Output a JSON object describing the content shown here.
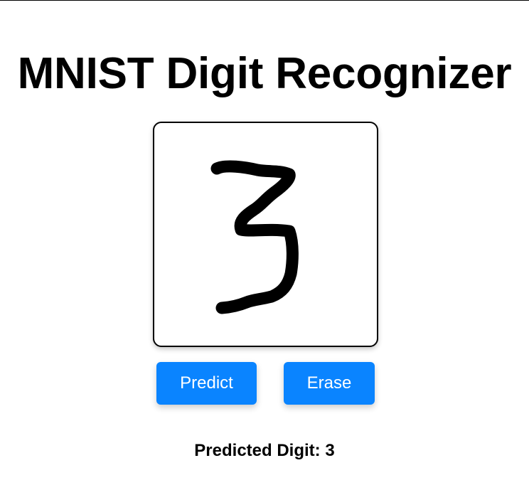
{
  "header": {
    "title": "MNIST Digit Recognizer"
  },
  "drawing_canvas": {
    "content": "handwritten digit 3",
    "stroke_color": "#000000",
    "background_color": "#ffffff"
  },
  "actions": {
    "predict_label": "Predict",
    "erase_label": "Erase",
    "button_color": "#0a84ff"
  },
  "result": {
    "label": "Predicted Digit: ",
    "value": "3"
  }
}
